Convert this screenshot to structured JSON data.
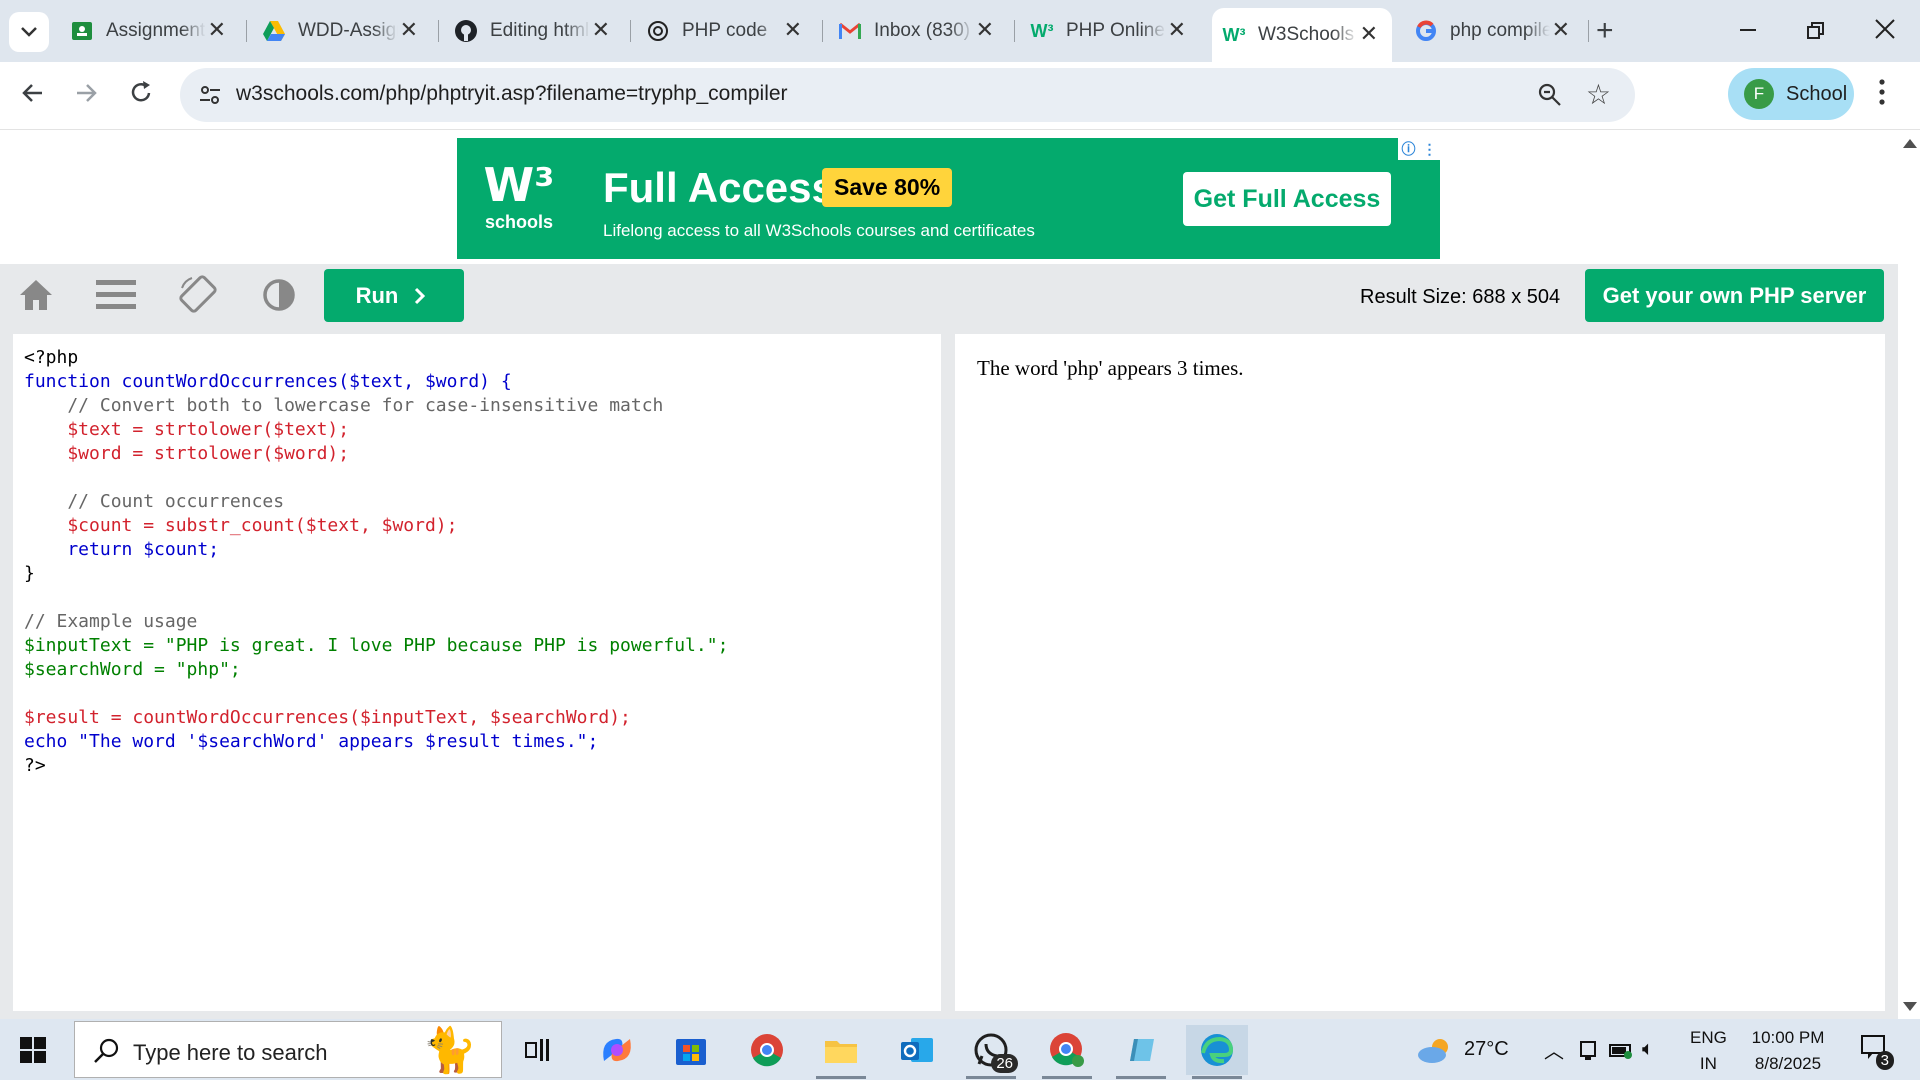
{
  "browser": {
    "tabs": [
      {
        "title": "Assignment",
        "favicon": "classroom-icon"
      },
      {
        "title": "WDD-Assignment",
        "favicon": "google-drive-icon"
      },
      {
        "title": "Editing html",
        "favicon": "github-icon"
      },
      {
        "title": "PHP code",
        "favicon": "chatgpt-icon"
      },
      {
        "title": "Inbox (830)",
        "favicon": "gmail-icon"
      },
      {
        "title": "PHP Online",
        "favicon": "w3schools-icon"
      },
      {
        "title": "W3Schools",
        "favicon": "w3schools-icon",
        "active": true
      },
      {
        "title": "php compiler",
        "favicon": "google-icon"
      }
    ],
    "url": "w3schools.com/php/phptryit.asp?filename=tryphp_compiler",
    "profile": {
      "initial": "F",
      "name": "School"
    }
  },
  "ad": {
    "logo_mark": "W³",
    "logo_text": "schools",
    "headline": "Full Access",
    "badge": "Save 80%",
    "subtitle": "Lifelong access to all W3Schools courses and certificates",
    "cta": "Get Full Access",
    "colors": {
      "bg": "#04aa6d",
      "badge": "#ffd43b"
    }
  },
  "tryit": {
    "run_label": "Run",
    "result_size_label": "Result Size: 688 x 504",
    "own_server_label": "Get your own PHP server",
    "accent": "#04aa6d"
  },
  "code_lines": [
    "<?php",
    "function countWordOccurrences($text, $word) {",
    "    // Convert both to lowercase for case-insensitive match",
    "    $text = strtolower($text);",
    "    $word = strtolower($word);",
    "",
    "    // Count occurrences",
    "    $count = substr_count($text, $word);",
    "    return $count;",
    "}",
    "",
    "// Example usage",
    "$inputText = \"PHP is great. I love PHP because PHP is powerful.\";",
    "$searchWord = \"php\";",
    "",
    "$result = countWordOccurrences($inputText, $searchWord);",
    "echo \"The word '$searchWord' appears $result times.\";",
    "?>"
  ],
  "result_output": "The word 'php' appears 3 times.",
  "taskbar": {
    "search_placeholder": "Type here to search",
    "whatsapp_badge": "26",
    "weather": "27°C",
    "lang_top": "ENG",
    "lang_bottom": "IN",
    "time": "10:00 PM",
    "date": "8/8/2025",
    "notifications": "3"
  }
}
